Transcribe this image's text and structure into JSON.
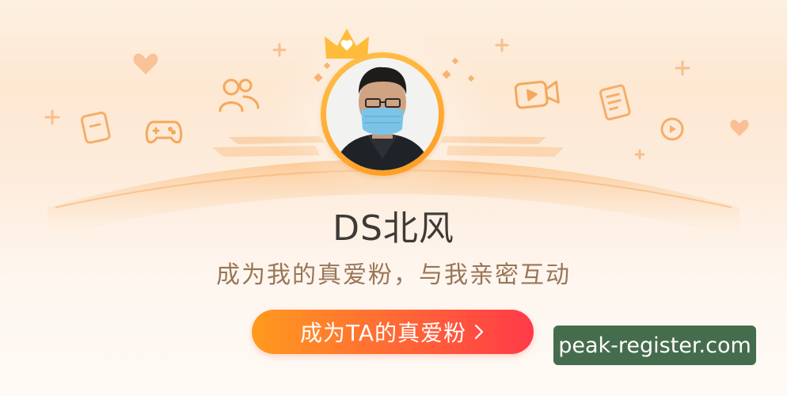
{
  "profile": {
    "name": "DS北风",
    "tagline": "成为我的真爱粉，与我亲密互动"
  },
  "cta": {
    "label": "成为TA的真爱粉"
  },
  "watermark": {
    "text": "peak-register.com"
  },
  "colors": {
    "background_top": "#fde8d2",
    "background_bottom": "#fffaf6",
    "accent_orange": "#ff9a1e",
    "accent_red": "#ff3a48",
    "ring_gold": "#ffb53a",
    "name_text": "#3e3a36",
    "tagline_text": "#9a7656",
    "watermark_bg": "#2c5a37"
  },
  "icons": [
    "heart-icon",
    "people-icon",
    "tablet-icon",
    "gamepad-icon",
    "video-camera-icon",
    "notebook-icon",
    "play-circle-icon",
    "plus-sparkle-icon",
    "crown-icon",
    "chevron-right-icon"
  ]
}
